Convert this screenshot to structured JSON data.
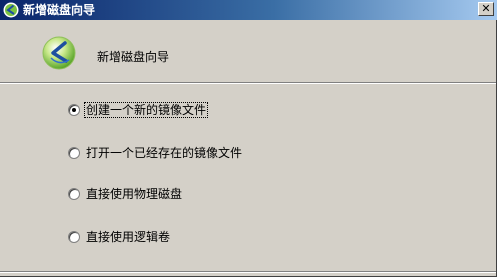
{
  "window": {
    "title": "新增磁盘向导",
    "close_symbol": "✕"
  },
  "header": {
    "title": "新增磁盘向导",
    "logo_icon": "wizard-logo-icon"
  },
  "options": [
    {
      "label": "创建一个新的镜像文件",
      "checked": true
    },
    {
      "label": "打开一个已经存在的镜像文件",
      "checked": false
    },
    {
      "label": "直接使用物理磁盘",
      "checked": false
    },
    {
      "label": "直接使用逻辑卷",
      "checked": false
    }
  ],
  "colors": {
    "titlebar_start": "#0a246a",
    "titlebar_end": "#a6caf0",
    "face": "#d4d0c8",
    "logo_green": "#7cc242",
    "logo_blue": "#1e4fa0"
  }
}
